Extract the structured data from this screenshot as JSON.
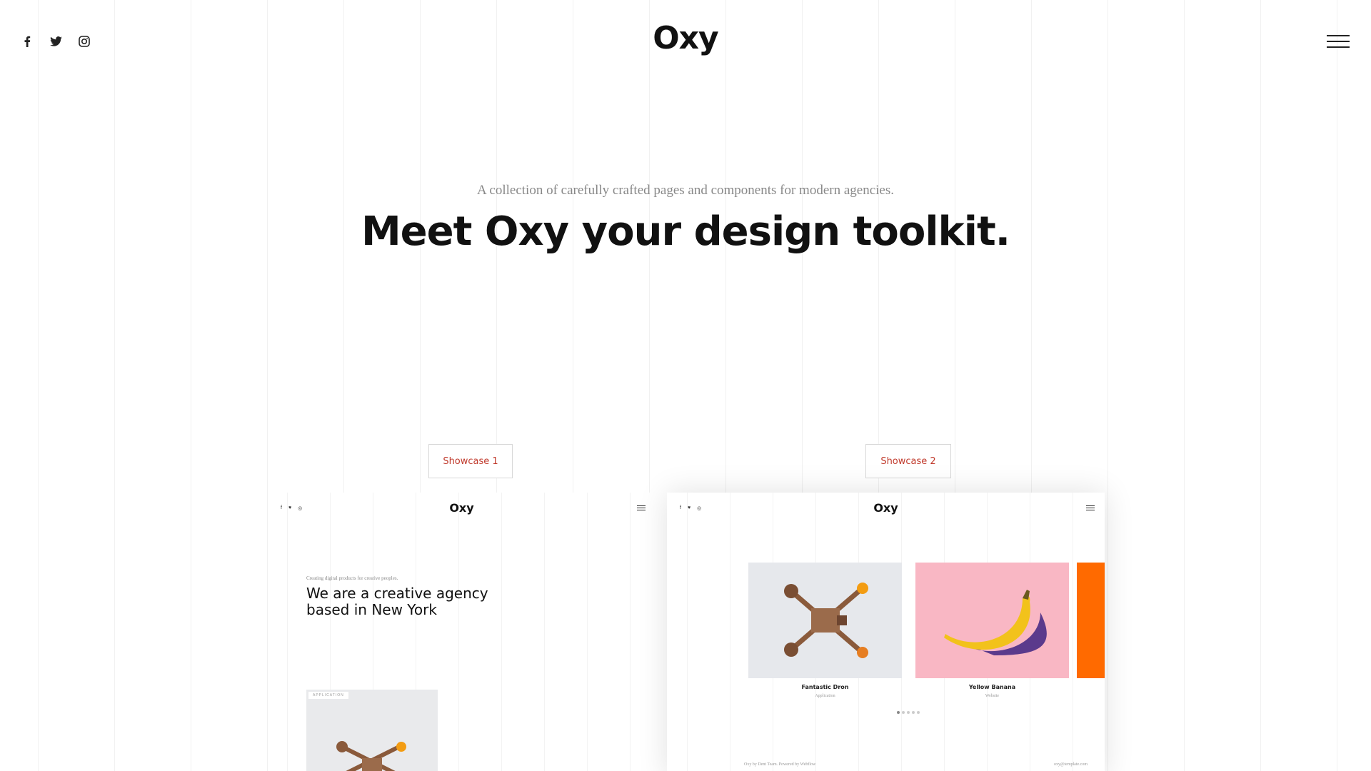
{
  "header": {
    "brand": "Oxy",
    "social": [
      "facebook-icon",
      "twitter-icon",
      "instagram-icon"
    ],
    "menu_icon": "hamburger-menu-icon"
  },
  "hero": {
    "tagline": "A collection of carefully crafted pages and components for modern agencies.",
    "headline": "Meet Oxy your design toolkit."
  },
  "showcases": [
    {
      "label": "Showcase 1"
    },
    {
      "label": "Showcase 2"
    }
  ],
  "preview1": {
    "brand": "Oxy",
    "tagline": "Creating digital products for creative peoples.",
    "headline": "We are a creative agency based in New York",
    "image_badge": "APPLICATION"
  },
  "preview2": {
    "brand": "Oxy",
    "items": [
      {
        "title": "Fantastic Dron",
        "category": "Application"
      },
      {
        "title": "Yellow Banana",
        "category": "Website"
      }
    ],
    "footer_left": "Oxy by Dent Team. Powered by Webflow",
    "footer_right": "oxy@template.com"
  },
  "colors": {
    "accent": "#c0392b",
    "pink": "#f9b7c4",
    "orange": "#ff6a00",
    "banana": "#f2c21b",
    "shadow_purple": "#5b3a8c"
  }
}
